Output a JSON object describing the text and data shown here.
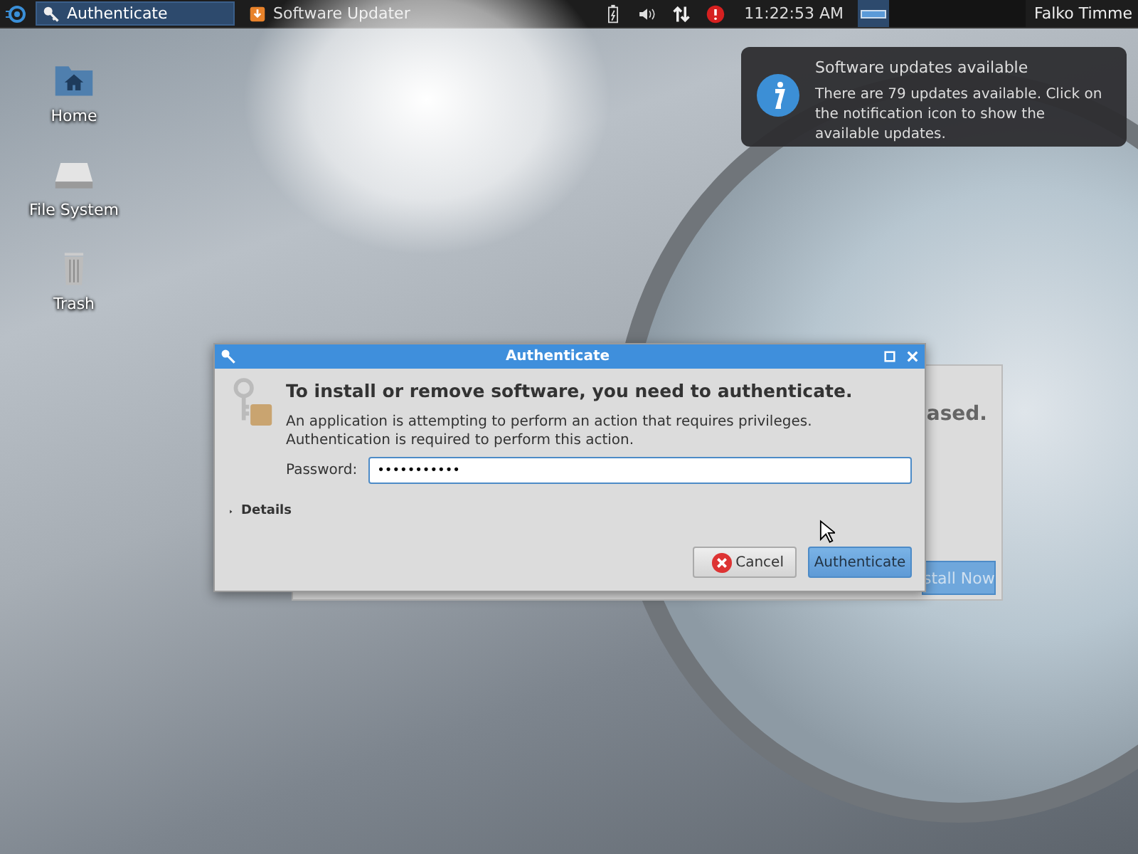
{
  "taskbar": {
    "tasks": [
      {
        "label": "Authenticate",
        "selected": true
      },
      {
        "label": "Software Updater",
        "selected": false
      }
    ],
    "clock": "11:22:53 AM",
    "user": "Falko Timme"
  },
  "desktop_icons": [
    {
      "label": "Home"
    },
    {
      "label": "File System"
    },
    {
      "label": "Trash"
    }
  ],
  "notification": {
    "title": "Software updates available",
    "body": "There are 79 updates available. Click on the notification icon to show the available updates."
  },
  "background_window": {
    "heading_fragment": "ased.",
    "button_fragment": "stall Now"
  },
  "dialog": {
    "title": "Authenticate",
    "heading": "To install or remove software, you need to authenticate.",
    "message": "An application is attempting to perform an action that requires privileges. Authentication is required to perform this action.",
    "password": {
      "label": "Password:",
      "value": "•••••••••••"
    },
    "details": {
      "label": "Details",
      "expanded": false
    },
    "buttons": [
      {
        "label": "Cancel",
        "kind": "cancel"
      },
      {
        "label": "Authenticate",
        "kind": "default"
      }
    ]
  }
}
